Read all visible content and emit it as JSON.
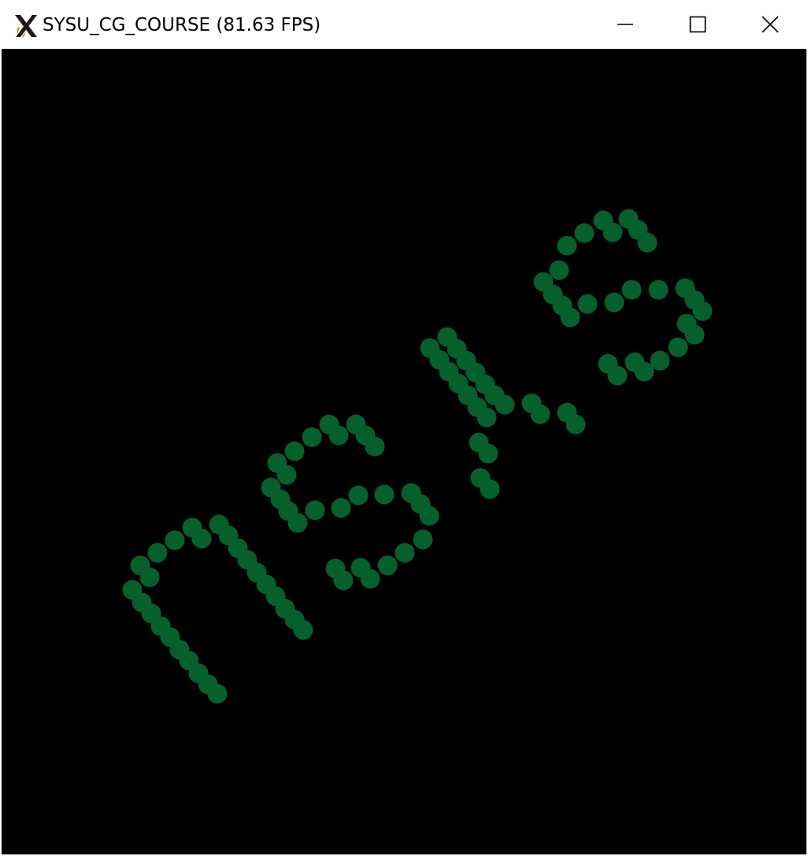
{
  "window": {
    "title": "SYSU_CG_COURSE (81.63 FPS)",
    "icon": "x-logo-icon",
    "controls": [
      "minimize",
      "maximize",
      "close"
    ]
  },
  "canvas": {
    "background": "#000000",
    "point_color": "#05602c",
    "text_shown": "nsʎs"
  }
}
